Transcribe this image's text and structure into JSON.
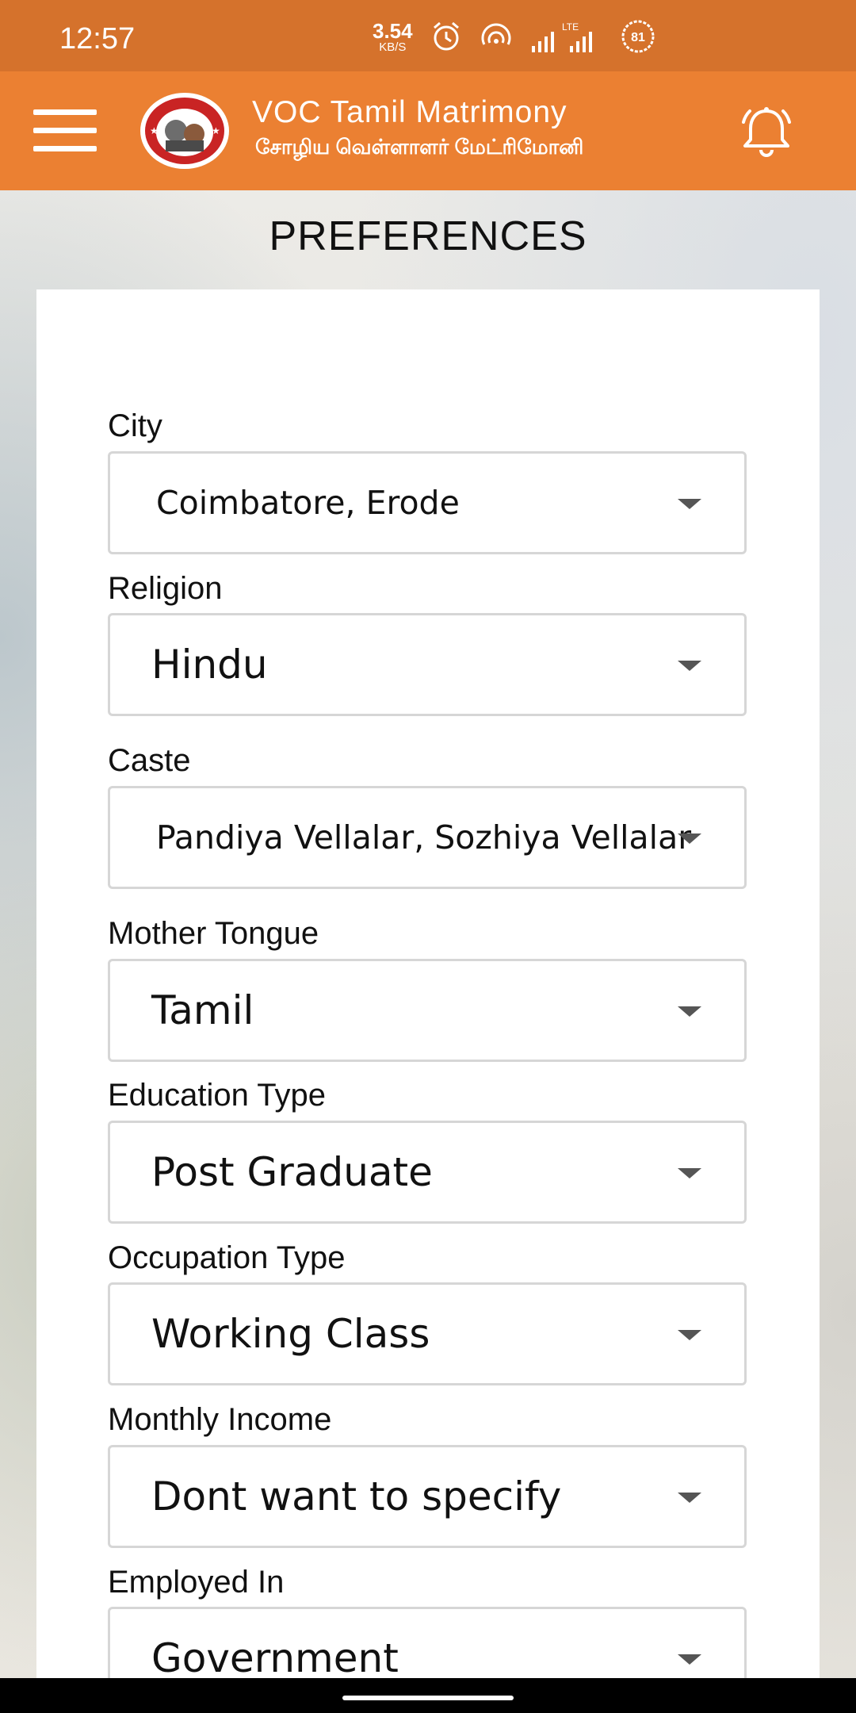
{
  "status_bar": {
    "time": "12:57",
    "net_speed_value": "3.54",
    "net_speed_unit": "KB/S",
    "lte_label": "LTE",
    "battery_level": "81"
  },
  "app_bar": {
    "brand_name": "VOC Tamil Matrimony",
    "brand_subtitle": "சோழிய வெள்ளாளர் மேட்ரிமோனி"
  },
  "page": {
    "title": "PREFERENCES"
  },
  "fields": [
    {
      "label": "City",
      "value": "Coimbatore, Erode"
    },
    {
      "label": "Religion",
      "value": "Hindu"
    },
    {
      "label": "Caste",
      "value": "Pandiya Vellalar, Sozhiya Vellalar"
    },
    {
      "label": "Mother Tongue",
      "value": "Tamil"
    },
    {
      "label": "Education Type",
      "value": "Post Graduate"
    },
    {
      "label": "Occupation Type",
      "value": "Working Class"
    },
    {
      "label": "Monthly Income",
      "value": "Dont want to specify"
    },
    {
      "label": "Employed In",
      "value": "Government"
    }
  ],
  "colors": {
    "status_bar": "#d5722c",
    "app_bar": "#eb8032",
    "card": "#ffffff"
  },
  "icons": {
    "menu": "hamburger-menu-icon",
    "notification": "bell-icon",
    "dropdown": "caret-down-icon"
  }
}
